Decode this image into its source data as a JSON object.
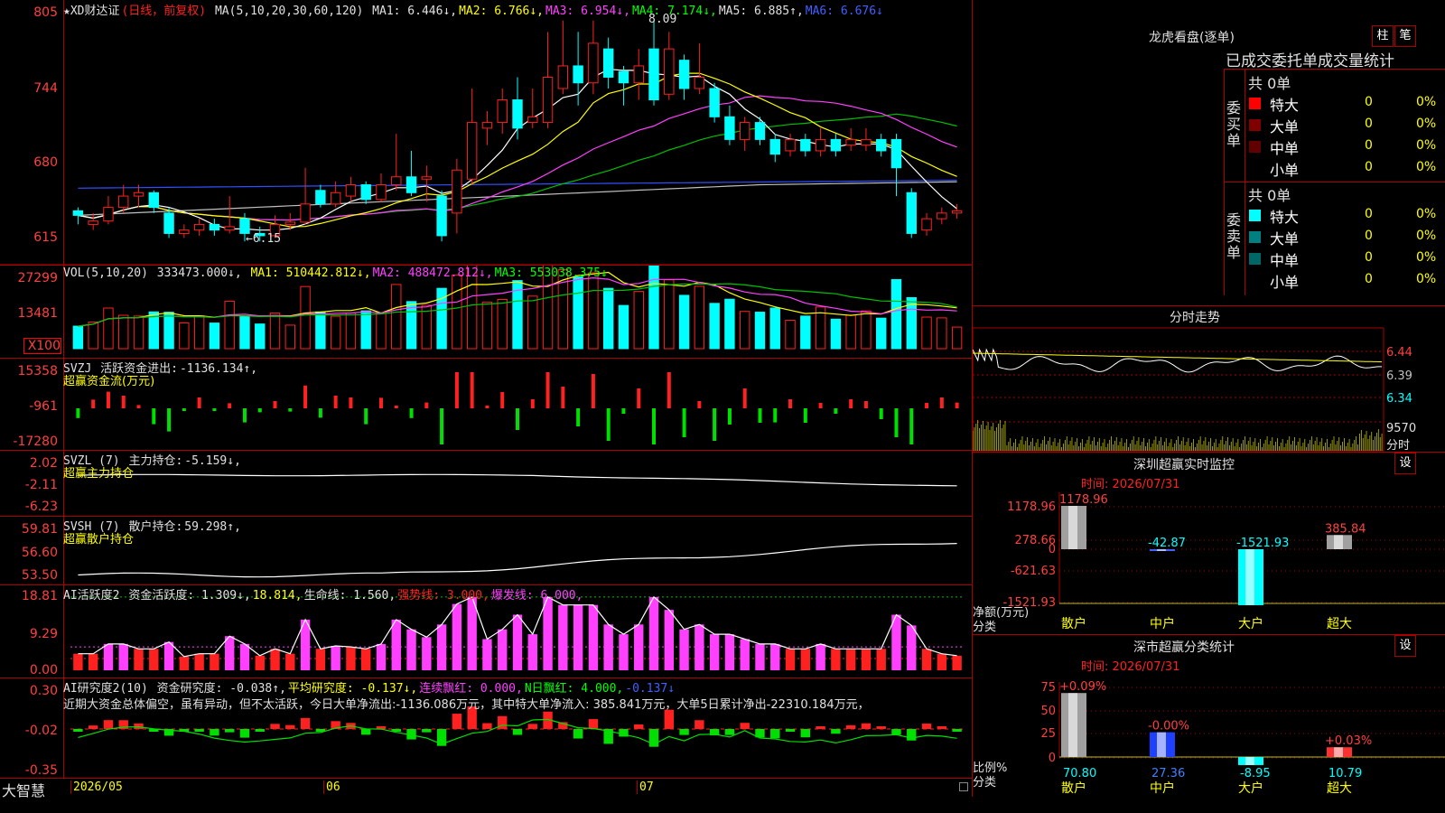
{
  "main": {
    "title": "★XD财达证",
    "period": "(日线，前复权)",
    "ma_params": "MA(5,10,20,30,60,120)",
    "ma": [
      {
        "label": "MA1:",
        "value": "6.446↓,",
        "color": "#e0e0e0"
      },
      {
        "label": "MA2:",
        "value": "6.766↓,",
        "color": "#ffff00"
      },
      {
        "label": "MA3:",
        "value": "6.954↓,",
        "color": "#ff40ff"
      },
      {
        "label": "MA4:",
        "value": "7.174↓,",
        "color": "#00ff00"
      },
      {
        "label": "MA5:",
        "value": "6.885↑,",
        "color": "#e0e0e0"
      },
      {
        "label": "MA6:",
        "value": "6.676↓",
        "color": "#4060ff"
      }
    ],
    "high_label": "8.09",
    "low_label": "←6.15",
    "ticks": [
      "805",
      "744",
      "680",
      "615"
    ]
  },
  "vol": {
    "header": "VOL(5,10,20)",
    "value": "333473.000↓,",
    "ma": [
      {
        "label": "MA1:",
        "value": "510442.812↓,",
        "color": "#ffff00"
      },
      {
        "label": "MA2:",
        "value": "488472.812↓,",
        "color": "#ff40ff"
      },
      {
        "label": "MA3:",
        "value": "553038.375↓",
        "color": "#00ff00"
      }
    ],
    "ticks": [
      "27299",
      "13481"
    ],
    "unit": "X100"
  },
  "svzj": {
    "header": "SVZJ",
    "label": "活跃资金进出:",
    "value": "-1136.134↑,",
    "sub": "超赢资金流(万元)",
    "ticks": [
      "15358",
      "-961",
      "-17280"
    ]
  },
  "svzl": {
    "header": "SVZL (7)",
    "label": "主力持仓:",
    "value": "-5.159↓,",
    "sub": "超赢主力持仓",
    "ticks": [
      "2.02",
      "-2.11",
      "-6.23"
    ]
  },
  "svsh": {
    "header": "SVSH (7)",
    "label": "散户持仓:",
    "value": "59.298↑,",
    "sub": "超赢散户持仓",
    "ticks": [
      "59.81",
      "56.60",
      "53.50"
    ]
  },
  "ai1": {
    "header": "AI活跃度2",
    "items": [
      {
        "text": "资金活跃度: 1.309↓,",
        "color": "#e0e0e0"
      },
      {
        "text": "18.814,",
        "color": "#ffff00"
      },
      {
        "text": "生命线: 1.560,",
        "color": "#e0e0e0"
      },
      {
        "text": "强势线: 3.000,",
        "color": "#ff2020"
      },
      {
        "text": "爆发线: 6.000,",
        "color": "#ff40ff"
      }
    ],
    "ticks": [
      "18.81",
      "9.29",
      "0.00"
    ]
  },
  "ai2": {
    "header": "AI研究度2(10)",
    "items": [
      {
        "text": "资金研究度: -0.038↑,",
        "color": "#e0e0e0"
      },
      {
        "text": "平均研究度: -0.137↓,",
        "color": "#ffff00"
      },
      {
        "text": "连续飘红: 0.000,",
        "color": "#ff40ff"
      },
      {
        "text": "N日飘红: 4.000,",
        "color": "#00ff00"
      },
      {
        "text": "-0.137↓",
        "color": "#4060ff"
      }
    ],
    "comment": "近期大资金总体偏空，虽有异动，但不太活跃，今日大单净流出:-1136.086万元，其中特大单净流入: 385.841万元，大单5日累计净出-22310.184万元，",
    "ticks": [
      "0.30",
      "-0.02",
      "-0.35"
    ]
  },
  "footer": {
    "brand": "大智慧",
    "dates": [
      "2026/05",
      "06",
      "07"
    ]
  },
  "dragon": {
    "title": "龙虎看盘(逐单)",
    "btn1": "柱",
    "btn2": "笔",
    "subtitle": "已成交委托单成交量统计",
    "buy_group": "委买单",
    "sell_group": "委卖单",
    "buy_total": "共 0单",
    "sell_total": "共 0单",
    "buy_rows": [
      {
        "name": "特大",
        "val": "0",
        "pct": "0%",
        "color": "#ff0000"
      },
      {
        "name": "大单",
        "val": "0",
        "pct": "0%",
        "color": "#800000"
      },
      {
        "name": "中单",
        "val": "0",
        "pct": "0%",
        "color": "#600000"
      },
      {
        "name": "小单",
        "val": "0",
        "pct": "0%",
        "color": ""
      }
    ],
    "sell_rows": [
      {
        "name": "特大",
        "val": "0",
        "pct": "0%",
        "color": "#00ffff"
      },
      {
        "name": "大单",
        "val": "0",
        "pct": "0%",
        "color": "#008080"
      },
      {
        "name": "中单",
        "val": "0",
        "pct": "0%",
        "color": "#006666"
      },
      {
        "name": "小单",
        "val": "0",
        "pct": "0%",
        "color": ""
      }
    ]
  },
  "intraday": {
    "title": "分时走势",
    "ticks": [
      "6.44",
      "6.39",
      "6.34"
    ],
    "vol_tick": "9570",
    "label": "分时"
  },
  "monitor": {
    "title": "深圳超赢实时监控",
    "set": "设",
    "time": "时间: 2026/07/31",
    "ticks": [
      "1178.96",
      "278.66",
      "0",
      "-621.63",
      "-1521.93"
    ],
    "ylabel": "净额(万元)",
    "xlabel": "分类",
    "cats": [
      "散户",
      "中户",
      "大户",
      "超大"
    ],
    "values": [
      1178.96,
      -42.87,
      -1521.93,
      385.84
    ],
    "value_labels": [
      "1178.96",
      "-42.87",
      "-1521.93",
      "385.84"
    ]
  },
  "classify": {
    "title": "深市超赢分类统计",
    "set": "设",
    "time": "时间: 2026/07/31",
    "ticks": [
      "75",
      "50",
      "25",
      "0"
    ],
    "ylabel": "比例%",
    "xlabel": "分类",
    "cats": [
      "散户",
      "中户",
      "大户",
      "超大"
    ],
    "pct_labels": [
      "+0.09%",
      "-0.00%",
      "",
      "+0.03%"
    ],
    "values": [
      70.8,
      27.36,
      -8.95,
      10.79
    ],
    "value_labels": [
      "70.80",
      "27.36",
      "-8.95",
      "10.79"
    ]
  },
  "chart_data": {
    "type": "candlestick",
    "x_ticks": [
      "2026/05",
      "06",
      "07"
    ],
    "price_range": [
      6.15,
      8.09
    ],
    "ohlc": [
      [
        6.42,
        6.38,
        6.45,
        6.3
      ],
      [
        6.3,
        6.33,
        6.4,
        6.25
      ],
      [
        6.33,
        6.45,
        6.55,
        6.3
      ],
      [
        6.45,
        6.55,
        6.65,
        6.4
      ],
      [
        6.55,
        6.58,
        6.65,
        6.45
      ],
      [
        6.58,
        6.45,
        6.6,
        6.4
      ],
      [
        6.4,
        6.22,
        6.45,
        6.18
      ],
      [
        6.22,
        6.25,
        6.3,
        6.18
      ],
      [
        6.25,
        6.3,
        6.35,
        6.2
      ],
      [
        6.3,
        6.25,
        6.35,
        6.2
      ],
      [
        6.25,
        6.28,
        6.55,
        6.22
      ],
      [
        6.35,
        6.22,
        6.4,
        6.15
      ],
      [
        6.22,
        6.2,
        6.28,
        6.15
      ],
      [
        6.2,
        6.3,
        6.38,
        6.18
      ],
      [
        6.3,
        6.32,
        6.4,
        6.25
      ],
      [
        6.32,
        6.48,
        6.8,
        6.3
      ],
      [
        6.6,
        6.48,
        6.65,
        6.45
      ],
      [
        6.48,
        6.58,
        6.68,
        6.45
      ],
      [
        6.55,
        6.65,
        6.72,
        6.5
      ],
      [
        6.65,
        6.52,
        6.68,
        6.48
      ],
      [
        6.52,
        6.65,
        6.75,
        6.5
      ],
      [
        6.65,
        6.72,
        7.1,
        6.6
      ],
      [
        6.72,
        6.58,
        6.95,
        6.55
      ],
      [
        6.7,
        6.72,
        6.82,
        6.5
      ],
      [
        6.55,
        6.2,
        6.6,
        6.15
      ],
      [
        6.4,
        6.78,
        6.88,
        6.22
      ],
      [
        6.7,
        7.2,
        7.5,
        6.65
      ],
      [
        7.15,
        7.2,
        7.3,
        7.0
      ],
      [
        7.2,
        7.4,
        7.5,
        7.1
      ],
      [
        7.4,
        7.15,
        7.6,
        7.05
      ],
      [
        7.2,
        7.25,
        7.5,
        7.15
      ],
      [
        7.2,
        7.6,
        8.0,
        7.15
      ],
      [
        7.5,
        7.7,
        8.1,
        7.45
      ],
      [
        7.7,
        7.55,
        8.0,
        7.35
      ],
      [
        7.55,
        7.9,
        8.1,
        7.45
      ],
      [
        7.85,
        7.6,
        7.95,
        7.5
      ],
      [
        7.65,
        7.55,
        7.7,
        7.35
      ],
      [
        7.55,
        7.7,
        7.85,
        7.4
      ],
      [
        7.85,
        7.4,
        8.09,
        7.35
      ],
      [
        7.45,
        7.85,
        8.0,
        7.4
      ],
      [
        7.75,
        7.5,
        7.8,
        7.4
      ],
      [
        7.5,
        7.6,
        7.9,
        7.45
      ],
      [
        7.5,
        7.25,
        7.55,
        7.2
      ],
      [
        7.25,
        7.05,
        7.35,
        7.0
      ],
      [
        7.05,
        7.2,
        7.25,
        6.95
      ],
      [
        7.2,
        7.05,
        7.25,
        7.0
      ],
      [
        7.05,
        6.92,
        7.1,
        6.85
      ],
      [
        6.95,
        7.05,
        7.1,
        6.9
      ],
      [
        7.05,
        6.95,
        7.1,
        6.9
      ],
      [
        6.95,
        7.05,
        7.15,
        6.9
      ],
      [
        7.05,
        6.95,
        7.1,
        6.9
      ],
      [
        7.0,
        7.05,
        7.15,
        6.95
      ],
      [
        7.0,
        7.05,
        7.15,
        6.95
      ],
      [
        7.05,
        6.95,
        7.1,
        6.9
      ],
      [
        7.05,
        6.8,
        7.1,
        6.55
      ],
      [
        6.58,
        6.22,
        6.62,
        6.18
      ],
      [
        6.25,
        6.35,
        6.4,
        6.2
      ],
      [
        6.35,
        6.4,
        6.45,
        6.3
      ],
      [
        6.4,
        6.42,
        6.48,
        6.35
      ]
    ]
  }
}
